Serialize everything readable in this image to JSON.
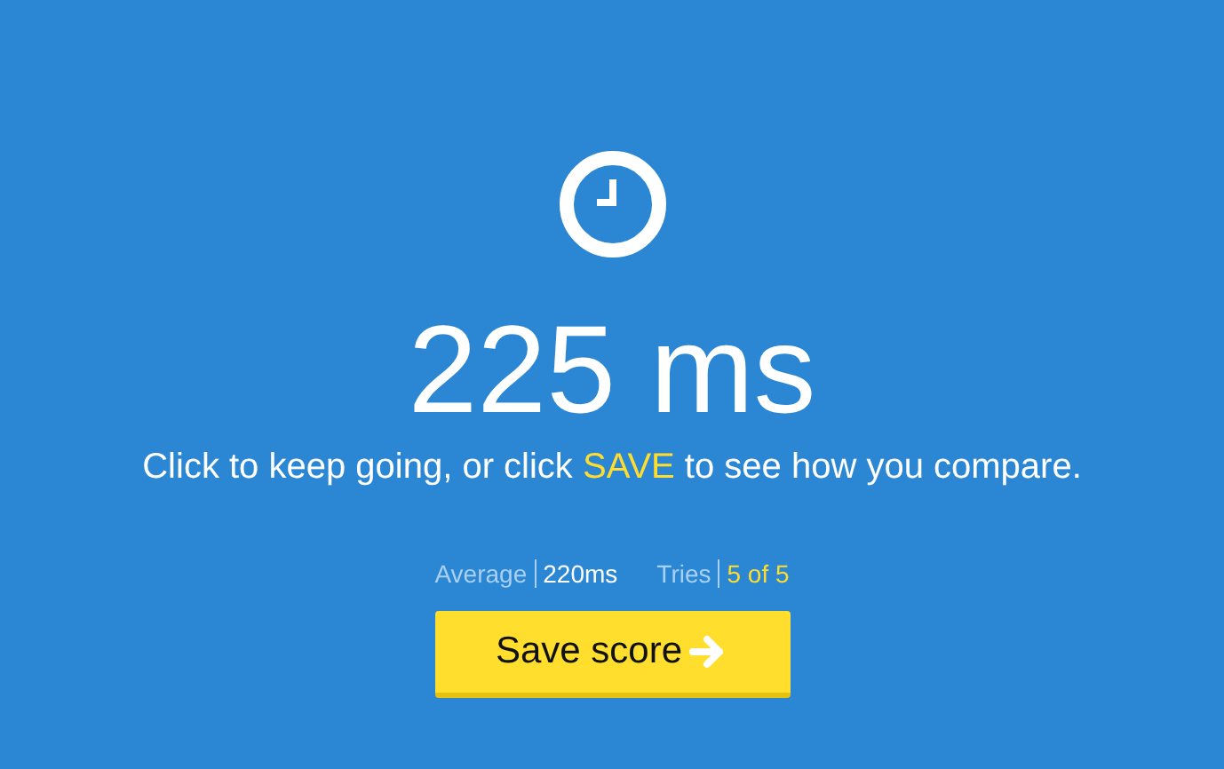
{
  "result": {
    "time": "225 ms"
  },
  "message": {
    "before": "Click to keep going, or click ",
    "link": "SAVE",
    "after": " to see how you compare."
  },
  "stats": [
    {
      "label": "Average",
      "value": "220ms",
      "highlight": false
    },
    {
      "label": "Tries",
      "value": "5 of 5",
      "highlight": true
    }
  ],
  "button": {
    "label": "Save score"
  }
}
